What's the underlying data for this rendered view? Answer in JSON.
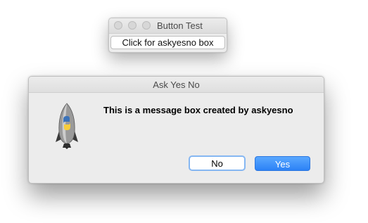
{
  "small_window": {
    "title": "Button Test",
    "button_label": "Click for askyesno box"
  },
  "dialog": {
    "title": "Ask Yes No",
    "message": "This is a message box created by askyesno",
    "icon": "python-rocket-icon",
    "no_label": "No",
    "yes_label": "Yes"
  },
  "colors": {
    "accent": "#2c82f6",
    "focus_ring": "#86b7f2",
    "window_bg": "#ececec"
  }
}
